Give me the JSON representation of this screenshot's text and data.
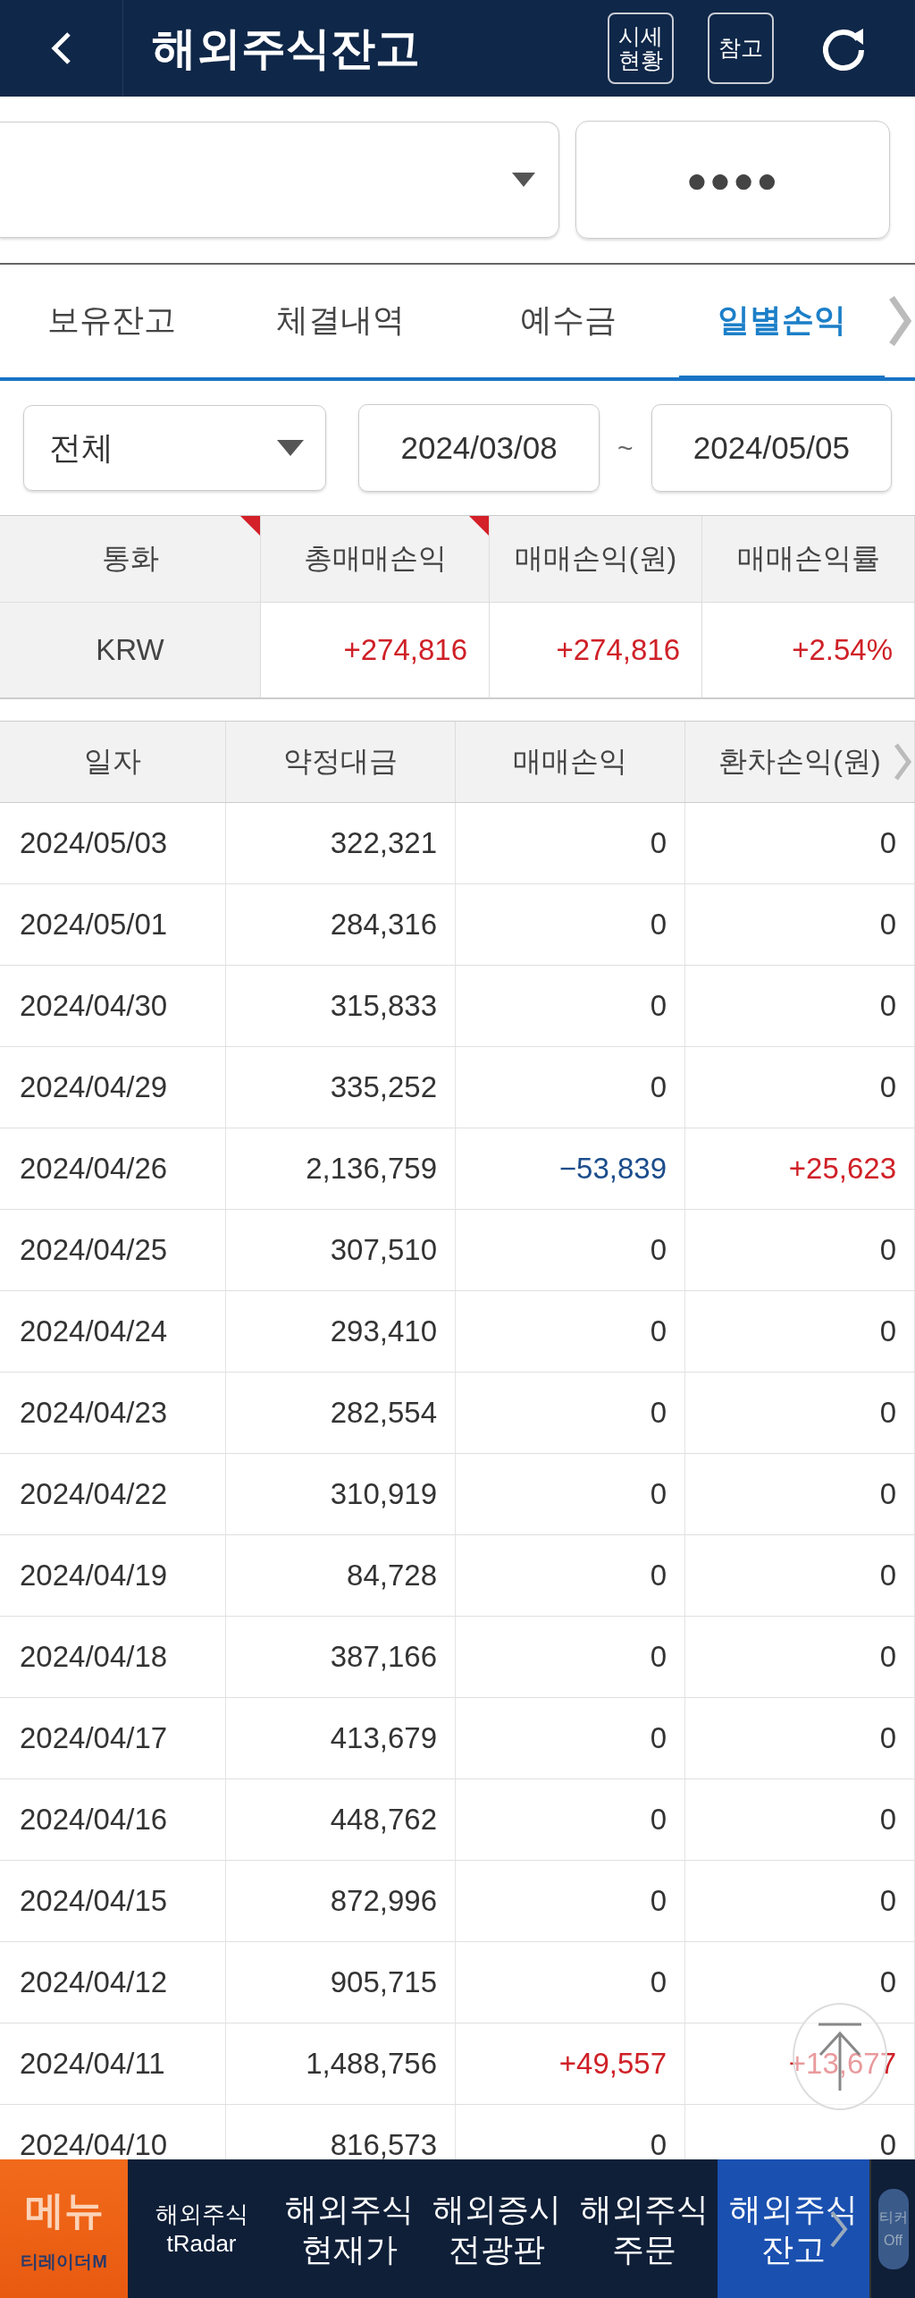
{
  "header": {
    "title": "해외주식잔고",
    "buttons": [
      "시세\n현황",
      "참고"
    ]
  },
  "account": {
    "password": "●●●●"
  },
  "tabs": [
    {
      "label": "보유잔고",
      "selected": false
    },
    {
      "label": "체결내역",
      "selected": false
    },
    {
      "label": "예수금",
      "selected": false
    },
    {
      "label": "일별손익",
      "selected": true
    }
  ],
  "filter": {
    "scope": "전체",
    "date_from": "2024/03/08",
    "separator": "~",
    "date_to": "2024/05/05"
  },
  "summary": {
    "columns": [
      {
        "label": "통화",
        "flagged": true
      },
      {
        "label": "총매매손익",
        "flagged": true
      },
      {
        "label": "매매손익(원)",
        "flagged": false
      },
      {
        "label": "매매손익률",
        "flagged": false
      }
    ],
    "row": {
      "currency": "KRW",
      "total": "+274,816",
      "pl_krw": "+274,816",
      "rate": "+2.54%"
    }
  },
  "table": {
    "columns": [
      "일자",
      "약정대금",
      "매매손익",
      "환차손익(원)"
    ],
    "rows": [
      {
        "date": "2024/05/03",
        "amount": "322,321",
        "pl": {
          "text": "0",
          "kind": "flat"
        },
        "fx": {
          "text": "0",
          "kind": "flat"
        }
      },
      {
        "date": "2024/05/01",
        "amount": "284,316",
        "pl": {
          "text": "0",
          "kind": "flat"
        },
        "fx": {
          "text": "0",
          "kind": "flat"
        }
      },
      {
        "date": "2024/04/30",
        "amount": "315,833",
        "pl": {
          "text": "0",
          "kind": "flat"
        },
        "fx": {
          "text": "0",
          "kind": "flat"
        }
      },
      {
        "date": "2024/04/29",
        "amount": "335,252",
        "pl": {
          "text": "0",
          "kind": "flat"
        },
        "fx": {
          "text": "0",
          "kind": "flat"
        }
      },
      {
        "date": "2024/04/26",
        "amount": "2,136,759",
        "pl": {
          "text": "−53,839",
          "kind": "loss"
        },
        "fx": {
          "text": "+25,623",
          "kind": "gain"
        }
      },
      {
        "date": "2024/04/25",
        "amount": "307,510",
        "pl": {
          "text": "0",
          "kind": "flat"
        },
        "fx": {
          "text": "0",
          "kind": "flat"
        }
      },
      {
        "date": "2024/04/24",
        "amount": "293,410",
        "pl": {
          "text": "0",
          "kind": "flat"
        },
        "fx": {
          "text": "0",
          "kind": "flat"
        }
      },
      {
        "date": "2024/04/23",
        "amount": "282,554",
        "pl": {
          "text": "0",
          "kind": "flat"
        },
        "fx": {
          "text": "0",
          "kind": "flat"
        }
      },
      {
        "date": "2024/04/22",
        "amount": "310,919",
        "pl": {
          "text": "0",
          "kind": "flat"
        },
        "fx": {
          "text": "0",
          "kind": "flat"
        }
      },
      {
        "date": "2024/04/19",
        "amount": "84,728",
        "pl": {
          "text": "0",
          "kind": "flat"
        },
        "fx": {
          "text": "0",
          "kind": "flat"
        }
      },
      {
        "date": "2024/04/18",
        "amount": "387,166",
        "pl": {
          "text": "0",
          "kind": "flat"
        },
        "fx": {
          "text": "0",
          "kind": "flat"
        }
      },
      {
        "date": "2024/04/17",
        "amount": "413,679",
        "pl": {
          "text": "0",
          "kind": "flat"
        },
        "fx": {
          "text": "0",
          "kind": "flat"
        }
      },
      {
        "date": "2024/04/16",
        "amount": "448,762",
        "pl": {
          "text": "0",
          "kind": "flat"
        },
        "fx": {
          "text": "0",
          "kind": "flat"
        }
      },
      {
        "date": "2024/04/15",
        "amount": "872,996",
        "pl": {
          "text": "0",
          "kind": "flat"
        },
        "fx": {
          "text": "0",
          "kind": "flat"
        }
      },
      {
        "date": "2024/04/12",
        "amount": "905,715",
        "pl": {
          "text": "0",
          "kind": "flat"
        },
        "fx": {
          "text": "0",
          "kind": "flat"
        }
      },
      {
        "date": "2024/04/11",
        "amount": "1,488,756",
        "pl": {
          "text": "+49,557",
          "kind": "gain"
        },
        "fx": {
          "text": "+13,677",
          "kind": "gain"
        }
      },
      {
        "date": "2024/04/10",
        "amount": "816,573",
        "pl": {
          "text": "0",
          "kind": "flat"
        },
        "fx": {
          "text": "0",
          "kind": "flat"
        }
      }
    ]
  },
  "bottom_nav": {
    "menu": {
      "label": "메뉴",
      "brand": "티레이더M"
    },
    "items": [
      {
        "lines": [
          "해외주식",
          "tRadar"
        ],
        "kind": "small",
        "selected": false
      },
      {
        "lines": [
          "해외주식",
          "현재가"
        ],
        "kind": "large",
        "selected": false
      },
      {
        "lines": [
          "해외증시",
          "전광판"
        ],
        "kind": "large",
        "selected": false
      },
      {
        "lines": [
          "해외주식",
          "주문"
        ],
        "kind": "large",
        "selected": false
      },
      {
        "lines": [
          "해외주식",
          "잔고"
        ],
        "kind": "large",
        "selected": true
      }
    ],
    "ticker": {
      "label": "티커",
      "state": "Off",
      "on": false
    }
  }
}
